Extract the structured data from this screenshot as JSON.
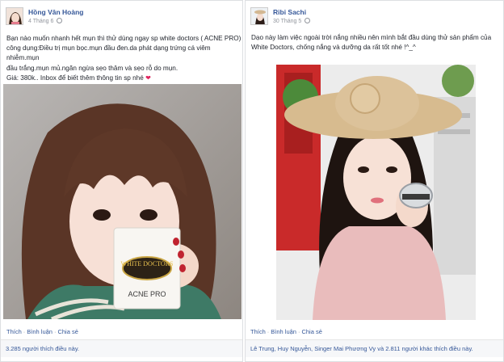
{
  "posts": [
    {
      "author": "Hồng Vân Hoàng",
      "date": "4 Tháng 6",
      "lines": [
        "Bạn nào muốn nhanh hết mụn thì thử dùng ngay sp white doctors ( ACNE PRO)",
        "công dụng:Điều trị mụn bọc.mụn đầu đen.da phát dạng trứng cá viêm nhiễm.mụn",
        "đầu trắng.mụn mủ.ngăn ngừa sẹo thâm và sẹo rỗ do mụn.",
        "Giá: 380k.. Inbox để biết thêm thông tin sp nhé"
      ],
      "heart_glyph": "❤",
      "product_box": {
        "logo": "WHITE DOCTORS",
        "name": "ACNE PRO"
      },
      "actions": [
        "Thích",
        "Bình luận",
        "Chia sẻ"
      ],
      "action_sep": "·",
      "likes_text": "3.285 người thích điều này."
    },
    {
      "author": "Ribi Sachi",
      "date": "30 Tháng 5",
      "lines": [
        "Dạo này làm việc ngoài trời nắng nhiều nên mình bắt đầu dùng thử sản phẩm của",
        "White Doctors, chống nắng và dưỡng da rất tốt nhé !^_^"
      ],
      "actions": [
        "Thích",
        "Bình luận",
        "Chia sẻ"
      ],
      "action_sep": "·",
      "likes_text": "Lê Trung, Huy Nguyễn, Singer Mai Phương Vy và 2.811 người khác thích điều này."
    }
  ],
  "colors": {
    "link": "#365899",
    "text": "#1d2129",
    "meta": "#90949c",
    "border": "#dddfe2",
    "heart": "#e0245e"
  }
}
